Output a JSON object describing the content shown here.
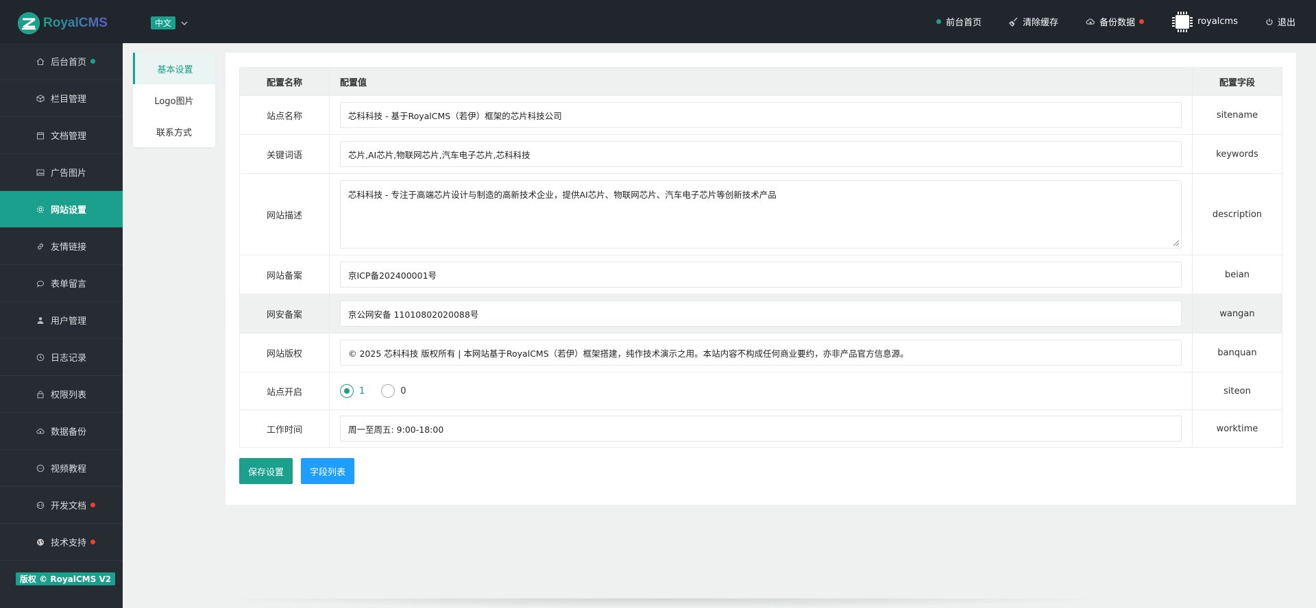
{
  "header": {
    "app_name": "RoyalCMS",
    "language": "中文",
    "nav": [
      {
        "label": "前台首页",
        "icon": "status-dot"
      },
      {
        "label": "清除缓存",
        "icon": "broom-icon"
      },
      {
        "label": "备份数据",
        "icon": "cloud-icon"
      },
      {
        "label": "royalcms",
        "icon": "chip-avatar"
      },
      {
        "label": "退出",
        "icon": "power-icon"
      }
    ]
  },
  "colors": {
    "accent": "#1aa08c",
    "alert": "#e8432b",
    "blue": "#1e9fff",
    "sidebar_bg": "#262c31",
    "header_bg": "#20262b"
  },
  "sidebar": {
    "items": [
      {
        "label": "后台首页",
        "icon": "home-icon"
      },
      {
        "label": "栏目管理",
        "icon": "cube-icon"
      },
      {
        "label": "文档管理",
        "icon": "calendar-icon"
      },
      {
        "label": "广告图片",
        "icon": "image-icon"
      },
      {
        "label": "网站设置",
        "icon": "gear-icon"
      },
      {
        "label": "友情链接",
        "icon": "link-icon"
      },
      {
        "label": "表单留言",
        "icon": "chat-icon"
      },
      {
        "label": "用户管理",
        "icon": "user-icon"
      },
      {
        "label": "日志记录",
        "icon": "clock-icon"
      },
      {
        "label": "权限列表",
        "icon": "lock-icon"
      },
      {
        "label": "数据备份",
        "icon": "cloud-upload-icon"
      },
      {
        "label": "视频教程",
        "icon": "video-icon"
      },
      {
        "label": "开发文档",
        "icon": "code-icon"
      },
      {
        "label": "技术支持",
        "icon": "globe-icon"
      }
    ],
    "copyright": "版权 © RoyalCMS V2"
  },
  "submenu": {
    "items": [
      {
        "label": "基本设置"
      },
      {
        "label": "Logo图片"
      },
      {
        "label": "联系方式"
      }
    ]
  },
  "table": {
    "headers": {
      "name": "配置名称",
      "value": "配置值",
      "field": "配置字段"
    },
    "rows": [
      {
        "name": "站点名称",
        "value": "芯科科技 - 基于RoyalCMS（若伊）框架的芯片科技公司",
        "field": "sitename"
      },
      {
        "name": "关键词语",
        "value": "芯片,AI芯片,物联网芯片,汽车电子芯片,芯科科技",
        "field": "keywords"
      },
      {
        "name": "网站描述",
        "value": "芯科科技 - 专注于高端芯片设计与制造的高新技术企业，提供AI芯片、物联网芯片、汽车电子芯片等创新技术产品",
        "field": "description"
      },
      {
        "name": "网站备案",
        "value": "京ICP备202400001号",
        "field": "beian"
      },
      {
        "name": "网安备案",
        "value": "京公网安备 11010802020088号",
        "field": "wangan"
      },
      {
        "name": "网站版权",
        "value": "© 2025 芯科科技 版权所有 | 本网站基于RoyalCMS（若伊）框架搭建，纯作技术演示之用。本站内容不构成任何商业要约，亦非产品官方信息源。",
        "field": "banquan"
      },
      {
        "name": "站点开启",
        "options": [
          "1",
          "0"
        ],
        "selected": "1",
        "field": "siteon"
      },
      {
        "name": "工作时间",
        "value": "周一至周五: 9:00-18:00",
        "field": "worktime"
      }
    ]
  },
  "buttons": {
    "save": "保存设置",
    "fields": "字段列表"
  }
}
